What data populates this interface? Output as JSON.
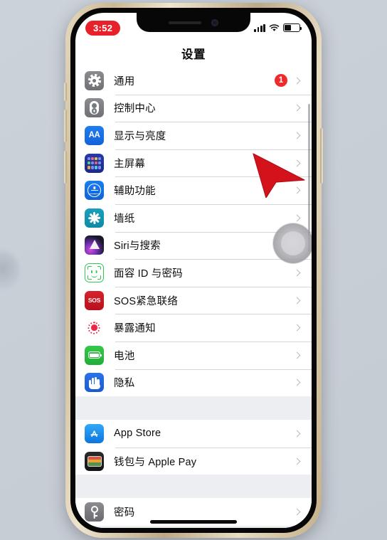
{
  "status_bar": {
    "time": "3:52",
    "time_badge_color": "#e8202a",
    "signal_icon": "cellular-signal-icon",
    "wifi_icon": "wifi-icon",
    "battery_icon": "battery-icon",
    "battery_level_percent": 45
  },
  "nav": {
    "title": "设置"
  },
  "sections": [
    {
      "id": "system",
      "rows": [
        {
          "label": "通用",
          "icon": "gear-icon",
          "badge": "1",
          "chevron": true
        },
        {
          "label": "控制中心",
          "icon": "control-center-icon",
          "badge": null,
          "chevron": true
        },
        {
          "label": "显示与亮度",
          "icon": "display-brightness-icon",
          "badge": null,
          "chevron": true
        },
        {
          "label": "主屏幕",
          "icon": "home-screen-icon",
          "badge": null,
          "chevron": true
        },
        {
          "label": "辅助功能",
          "icon": "accessibility-icon",
          "badge": null,
          "chevron": true
        },
        {
          "label": "墙纸",
          "icon": "wallpaper-icon",
          "badge": null,
          "chevron": true
        },
        {
          "label": "Siri与搜索",
          "icon": "siri-icon",
          "badge": null,
          "chevron": true
        },
        {
          "label": "面容 ID 与密码",
          "icon": "face-id-icon",
          "badge": null,
          "chevron": true
        },
        {
          "label": "SOS紧急联络",
          "icon": "sos-icon",
          "badge": null,
          "chevron": true
        },
        {
          "label": "暴露通知",
          "icon": "exposure-notification-icon",
          "badge": null,
          "chevron": true
        },
        {
          "label": "电池",
          "icon": "battery-settings-icon",
          "badge": null,
          "chevron": true
        },
        {
          "label": "隐私",
          "icon": "privacy-hand-icon",
          "badge": null,
          "chevron": true
        }
      ]
    },
    {
      "id": "store",
      "rows": [
        {
          "label": "App Store",
          "icon": "app-store-icon",
          "badge": null,
          "chevron": true
        },
        {
          "label": "钱包与 Apple Pay",
          "icon": "wallet-icon",
          "badge": null,
          "chevron": true
        }
      ]
    },
    {
      "id": "passwords",
      "rows": [
        {
          "label": "密码",
          "icon": "passwords-key-icon",
          "badge": null,
          "chevron": true
        }
      ]
    }
  ],
  "overlays": {
    "assistive_touch": "assistive-touch-button",
    "cursor": "red-pointer-arrow",
    "cursor_color": "#d4121c",
    "scrollbar": "vertical-scrollbar",
    "home_indicator": "home-indicator"
  },
  "device": {
    "frame_color": "#d8c7a3",
    "bezel_color": "#070707",
    "backdrop_color": "#c9cfd7"
  }
}
